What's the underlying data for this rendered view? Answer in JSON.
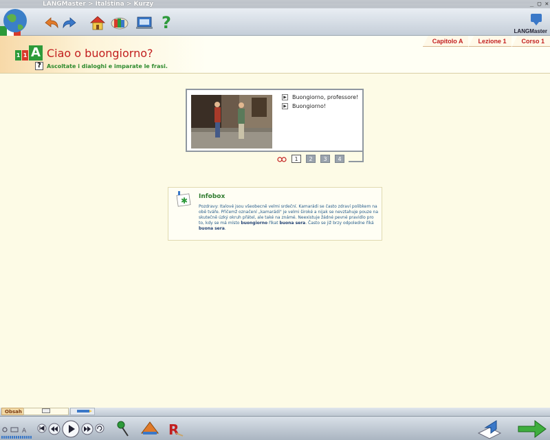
{
  "window": {
    "breadcrumb": "LANGMaster > Italština > Kurzy",
    "controls": "_ ▢ ✕"
  },
  "toolbar": {
    "icons": [
      "back-arrow-icon",
      "forward-arrow-icon",
      "home-icon",
      "books-icon",
      "dictionary-icon",
      "help-icon"
    ],
    "help_glyph": "?",
    "logo_text": "LANGMaster"
  },
  "header": {
    "crumbs": [
      "Capitolo A",
      "Lezione 1",
      "Corso 1"
    ],
    "level_digits": [
      "1",
      "1"
    ],
    "level_letter": "A",
    "title": "Ciao o buongiorno?",
    "help_glyph": "?",
    "subtitle": "Ascoltate i dialoghi e imparate le frasi."
  },
  "dialogue": {
    "lines": [
      "Buongiorno, professore!",
      "Buongiorno!"
    ],
    "pages": [
      "1",
      "2",
      "3",
      "4"
    ],
    "active_page": "1"
  },
  "infobox": {
    "title": "Infobox",
    "text_1": "Pozdravy: Italové jsou všeobecně velmi srdeční. Kamarádi se často zdraví polibkem na obě tváře. Přičemž označení „kamarádi\" je velmi široké a nijak se nevztahuje pouze na skutečně úzký okruh přátel, ale také na známé. Neexistuje žádné pevné pravidlo pro to, kdy se má místo ",
    "bold_1": "buongiorno",
    "text_2": " říkat ",
    "bold_2": "buona sera",
    "text_3": ". Často se již brzy odpoledne říká ",
    "bold_3": "buona sera",
    "text_4": "."
  },
  "bottom": {
    "tab_label": "Obsah"
  },
  "colors": {
    "title_red": "#c21e1e",
    "green": "#2d8a2d",
    "background": "#fdfbe6"
  }
}
